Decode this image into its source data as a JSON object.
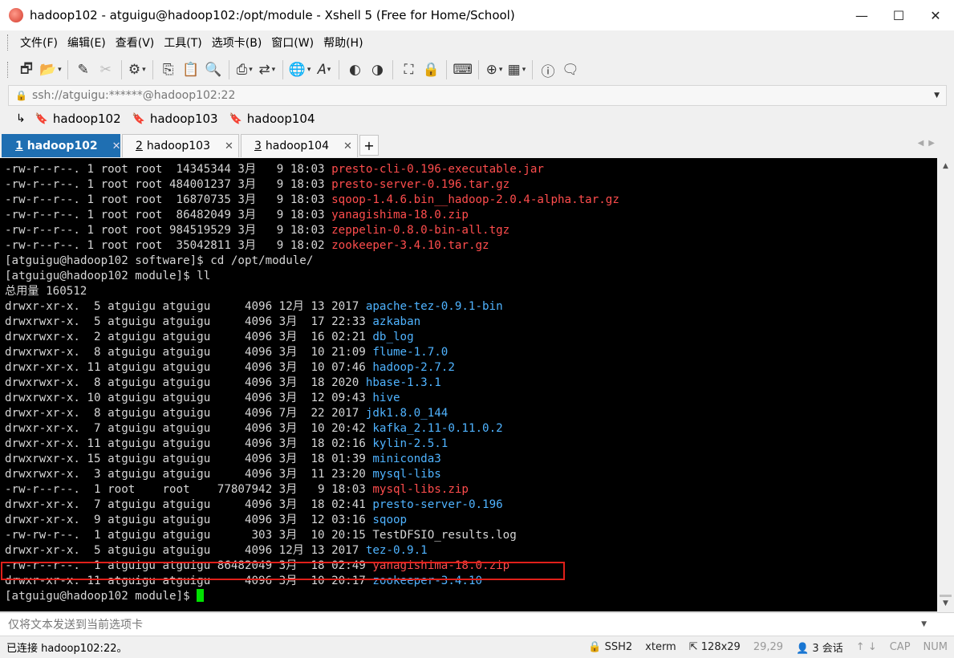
{
  "window": {
    "title": "hadoop102 - atguigu@hadoop102:/opt/module - Xshell 5 (Free for Home/School)"
  },
  "menu": [
    "文件(F)",
    "编辑(E)",
    "查看(V)",
    "工具(T)",
    "选项卡(B)",
    "窗口(W)",
    "帮助(H)"
  ],
  "address": {
    "value": "ssh://atguigu:******@hadoop102:22"
  },
  "links": [
    "hadoop102",
    "hadoop103",
    "hadoop104"
  ],
  "tabs": [
    {
      "num": "1",
      "label": "hadoop102",
      "active": true
    },
    {
      "num": "2",
      "label": "hadoop103",
      "active": false
    },
    {
      "num": "3",
      "label": "hadoop104",
      "active": false
    }
  ],
  "terminal": {
    "lines": [
      {
        "prefix": "-rw-r--r--. 1 root root  14345344 3月   9 18:03 ",
        "name": "presto-cli-0.196-executable.jar",
        "color": "red"
      },
      {
        "prefix": "-rw-r--r--. 1 root root 484001237 3月   9 18:03 ",
        "name": "presto-server-0.196.tar.gz",
        "color": "red"
      },
      {
        "prefix": "-rw-r--r--. 1 root root  16870735 3月   9 18:03 ",
        "name": "sqoop-1.4.6.bin__hadoop-2.0.4-alpha.tar.gz",
        "color": "red"
      },
      {
        "prefix": "-rw-r--r--. 1 root root  86482049 3月   9 18:03 ",
        "name": "yanagishima-18.0.zip",
        "color": "red"
      },
      {
        "prefix": "-rw-r--r--. 1 root root 984519529 3月   9 18:03 ",
        "name": "zeppelin-0.8.0-bin-all.tgz",
        "color": "red"
      },
      {
        "prefix": "-rw-r--r--. 1 root root  35042811 3月   9 18:02 ",
        "name": "zookeeper-3.4.10.tar.gz",
        "color": "red"
      },
      {
        "prefix": "[atguigu@hadoop102 software]$ cd /opt/module/",
        "name": "",
        "color": ""
      },
      {
        "prefix": "[atguigu@hadoop102 module]$ ll",
        "name": "",
        "color": ""
      },
      {
        "prefix": "总用量 160512",
        "name": "",
        "color": ""
      },
      {
        "prefix": "drwxr-xr-x.  5 atguigu atguigu     4096 12月 13 2017 ",
        "name": "apache-tez-0.9.1-bin",
        "color": "blue"
      },
      {
        "prefix": "drwxrwxr-x.  5 atguigu atguigu     4096 3月  17 22:33 ",
        "name": "azkaban",
        "color": "blue"
      },
      {
        "prefix": "drwxrwxr-x.  2 atguigu atguigu     4096 3月  16 02:21 ",
        "name": "db_log",
        "color": "blue"
      },
      {
        "prefix": "drwxrwxr-x.  8 atguigu atguigu     4096 3月  10 21:09 ",
        "name": "flume-1.7.0",
        "color": "blue"
      },
      {
        "prefix": "drwxr-xr-x. 11 atguigu atguigu     4096 3月  10 07:46 ",
        "name": "hadoop-2.7.2",
        "color": "blue"
      },
      {
        "prefix": "drwxrwxr-x.  8 atguigu atguigu     4096 3月  18 2020 ",
        "name": "hbase-1.3.1",
        "color": "blue"
      },
      {
        "prefix": "drwxrwxr-x. 10 atguigu atguigu     4096 3月  12 09:43 ",
        "name": "hive",
        "color": "blue"
      },
      {
        "prefix": "drwxr-xr-x.  8 atguigu atguigu     4096 7月  22 2017 ",
        "name": "jdk1.8.0_144",
        "color": "blue"
      },
      {
        "prefix": "drwxr-xr-x.  7 atguigu atguigu     4096 3月  10 20:42 ",
        "name": "kafka_2.11-0.11.0.2",
        "color": "blue"
      },
      {
        "prefix": "drwxr-xr-x. 11 atguigu atguigu     4096 3月  18 02:16 ",
        "name": "kylin-2.5.1",
        "color": "blue"
      },
      {
        "prefix": "drwxrwxr-x. 15 atguigu atguigu     4096 3月  18 01:39 ",
        "name": "miniconda3",
        "color": "blue"
      },
      {
        "prefix": "drwxrwxr-x.  3 atguigu atguigu     4096 3月  11 23:20 ",
        "name": "mysql-libs",
        "color": "blue"
      },
      {
        "prefix": "-rw-r--r--.  1 root    root    77807942 3月   9 18:03 ",
        "name": "mysql-libs.zip",
        "color": "red"
      },
      {
        "prefix": "drwxr-xr-x.  7 atguigu atguigu     4096 3月  18 02:41 ",
        "name": "presto-server-0.196",
        "color": "blue"
      },
      {
        "prefix": "drwxr-xr-x.  9 atguigu atguigu     4096 3月  12 03:16 ",
        "name": "sqoop",
        "color": "blue"
      },
      {
        "prefix": "-rw-rw-r--.  1 atguigu atguigu      303 3月  10 20:15 ",
        "name": "TestDFSIO_results.log",
        "color": "grey"
      },
      {
        "prefix": "drwxr-xr-x.  5 atguigu atguigu     4096 12月 13 2017 ",
        "name": "tez-0.9.1",
        "color": "blue"
      },
      {
        "prefix": "-rw-r--r--.  1 atguigu atguigu 86482049 3月  18 02:49 ",
        "name": "yanagishima-18.0.zip",
        "color": "red"
      },
      {
        "prefix": "drwxr-xr-x. 11 atguigu atguigu     4096 3月  10 20:17 ",
        "name": "zookeeper-3.4.10",
        "color": "blue"
      }
    ],
    "prompt": "[atguigu@hadoop102 module]$ "
  },
  "send_bar": {
    "placeholder": "仅将文本发送到当前选项卡"
  },
  "status": {
    "connection": "已连接 hadoop102:22。",
    "protocol": "SSH2",
    "term": "xterm",
    "size": "128x29",
    "position": "29,29",
    "sessions": "3 会话",
    "cap": "CAP",
    "num": "NUM"
  },
  "colors": {
    "terminal_bg": "#000000",
    "archive_red": "#ff4d4d",
    "directory_blue": "#4fb3ff",
    "cursor_green": "#00e100",
    "active_tab": "#1f6fb2",
    "highlight_box": "#e0201a"
  }
}
